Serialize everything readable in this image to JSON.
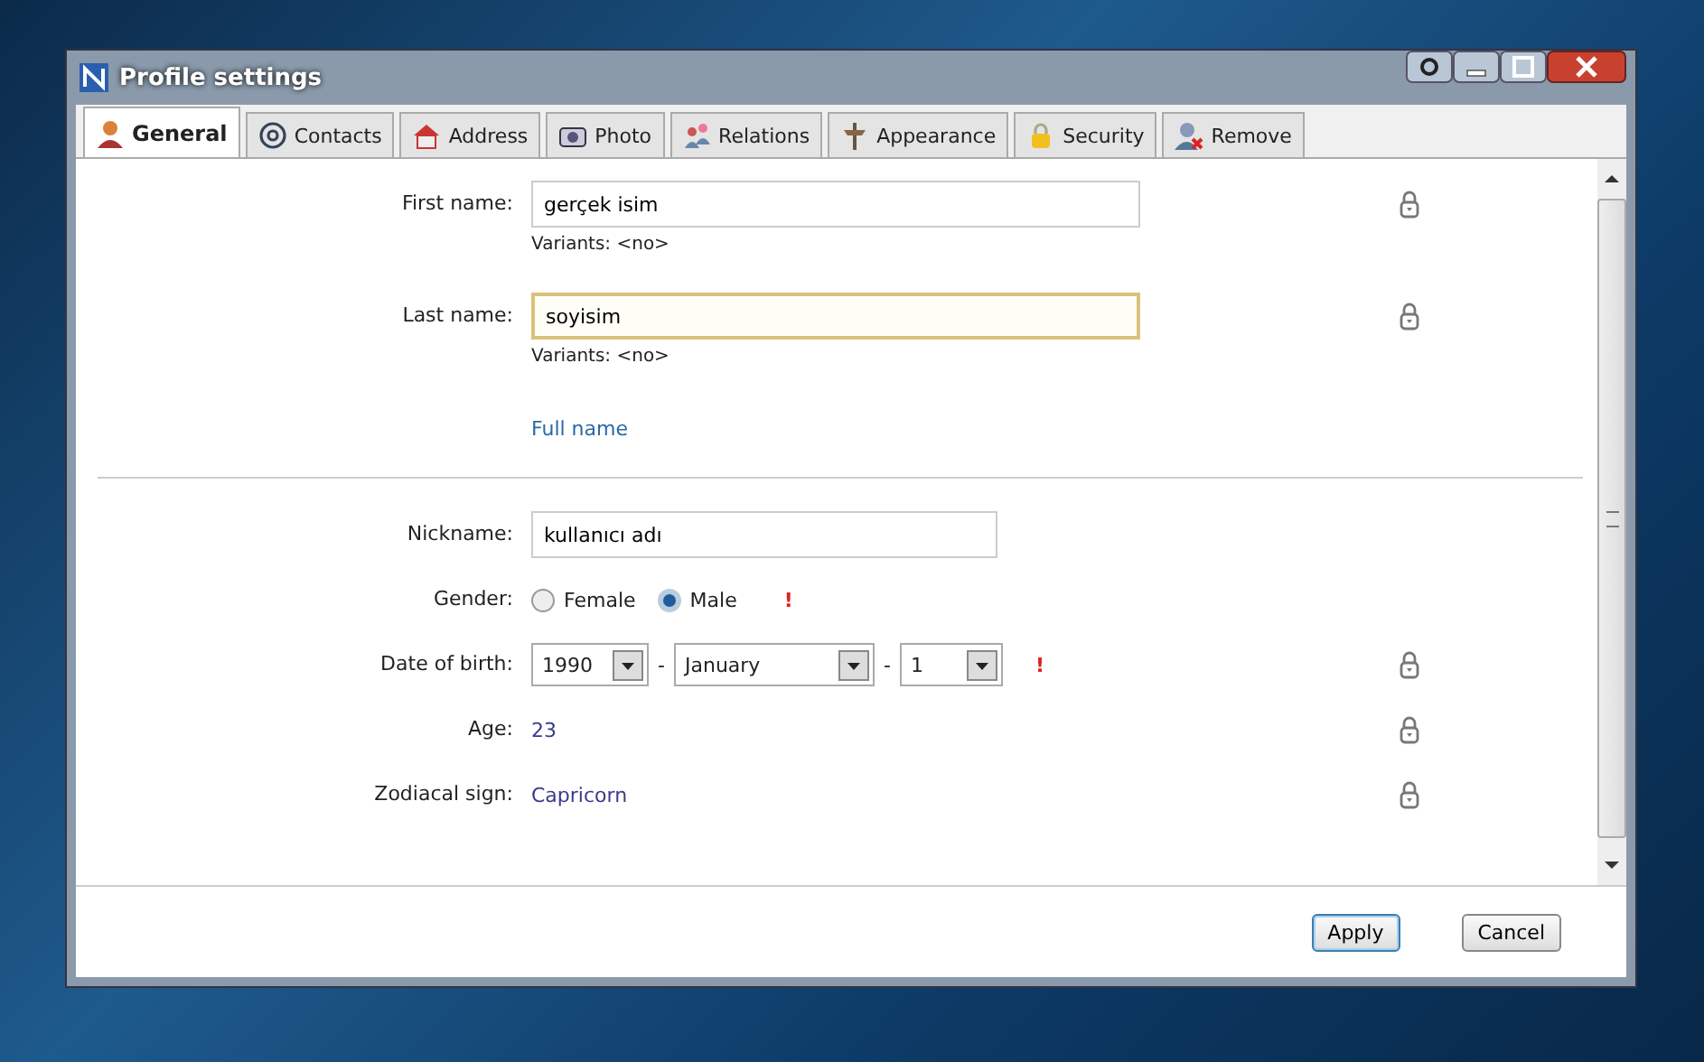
{
  "window": {
    "title": "Profile settings"
  },
  "tabs": [
    {
      "label": "General",
      "selected": true
    },
    {
      "label": "Contacts",
      "selected": false
    },
    {
      "label": "Address",
      "selected": false
    },
    {
      "label": "Photo",
      "selected": false
    },
    {
      "label": "Relations",
      "selected": false
    },
    {
      "label": "Appearance",
      "selected": false
    },
    {
      "label": "Security",
      "selected": false
    },
    {
      "label": "Remove",
      "selected": false
    }
  ],
  "sections": [
    {
      "rows": [
        {
          "kind": "field",
          "label": "First name:",
          "value": "gerçek isim",
          "focused": false,
          "hint": "Variants: <no>",
          "locked": true
        },
        {
          "kind": "field",
          "label": "Last name:",
          "value": "soyisim",
          "focused": true,
          "hint": "Variants: <no>",
          "locked": true
        },
        {
          "kind": "link",
          "text": "Full name"
        }
      ]
    },
    {
      "rows": [
        {
          "kind": "short_field",
          "label": "Nickname:",
          "value": "kullanıcı adı",
          "focused": false
        },
        {
          "kind": "radio",
          "label": "Gender:",
          "options": [
            {
              "label": "Female",
              "selected": false
            },
            {
              "label": "Male",
              "selected": true
            }
          ],
          "required_mark": "!"
        },
        {
          "kind": "date",
          "label": "Date of birth:",
          "parts": [
            {
              "kind": "select",
              "value": "1990"
            },
            {
              "kind": "sep",
              "text": "-"
            },
            {
              "kind": "select",
              "value": "January"
            },
            {
              "kind": "sep",
              "text": "-"
            },
            {
              "kind": "select",
              "value": "1"
            }
          ],
          "required_mark": "!",
          "locked": true
        },
        {
          "kind": "value",
          "label": "Age:",
          "value": "23",
          "locked": true
        },
        {
          "kind": "value",
          "label": "Zodiacal sign:",
          "value": "Capricorn",
          "locked": true
        }
      ]
    }
  ],
  "buttons": [
    {
      "label": "Apply",
      "default": true
    },
    {
      "label": "Cancel",
      "default": false
    }
  ]
}
